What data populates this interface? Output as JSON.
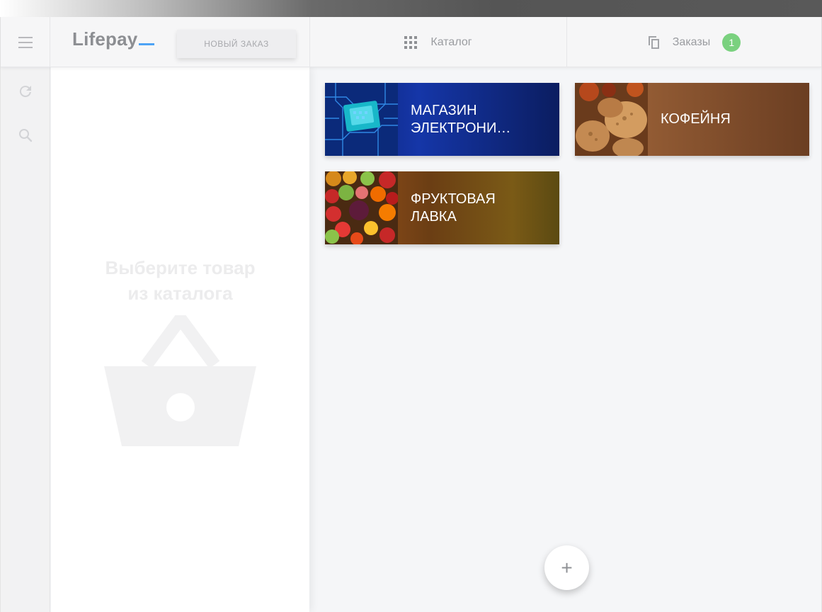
{
  "app": {
    "logo": "Lifepay",
    "new_order_label": "НОВЫЙ ЗАКАЗ"
  },
  "tabs": {
    "catalog_label": "Каталог",
    "orders_label": "Заказы",
    "orders_badge": "1"
  },
  "order_panel": {
    "empty_hint_line1": "Выберите товар",
    "empty_hint_line2": "из каталога"
  },
  "catalog": {
    "cards": [
      {
        "line1": "МАГАЗИН",
        "line2": "ЭЛЕКТРОНИ…",
        "image": "circuit-board-image"
      },
      {
        "line1": "КОФЕЙНЯ",
        "line2": "",
        "image": "pastry-image"
      },
      {
        "line1": "ФРУКТОВАЯ",
        "line2": "ЛАВКА",
        "image": "fruits-image"
      }
    ],
    "fab_label": "+"
  },
  "icons": {
    "menu": "hamburger-icon",
    "refresh": "refresh-icon",
    "search": "search-icon",
    "catalog": "grid-icon",
    "orders": "copy-icon",
    "empty": "basket-icon"
  },
  "colors": {
    "accent": "#4da3f5",
    "badge": "#7ad17f"
  }
}
